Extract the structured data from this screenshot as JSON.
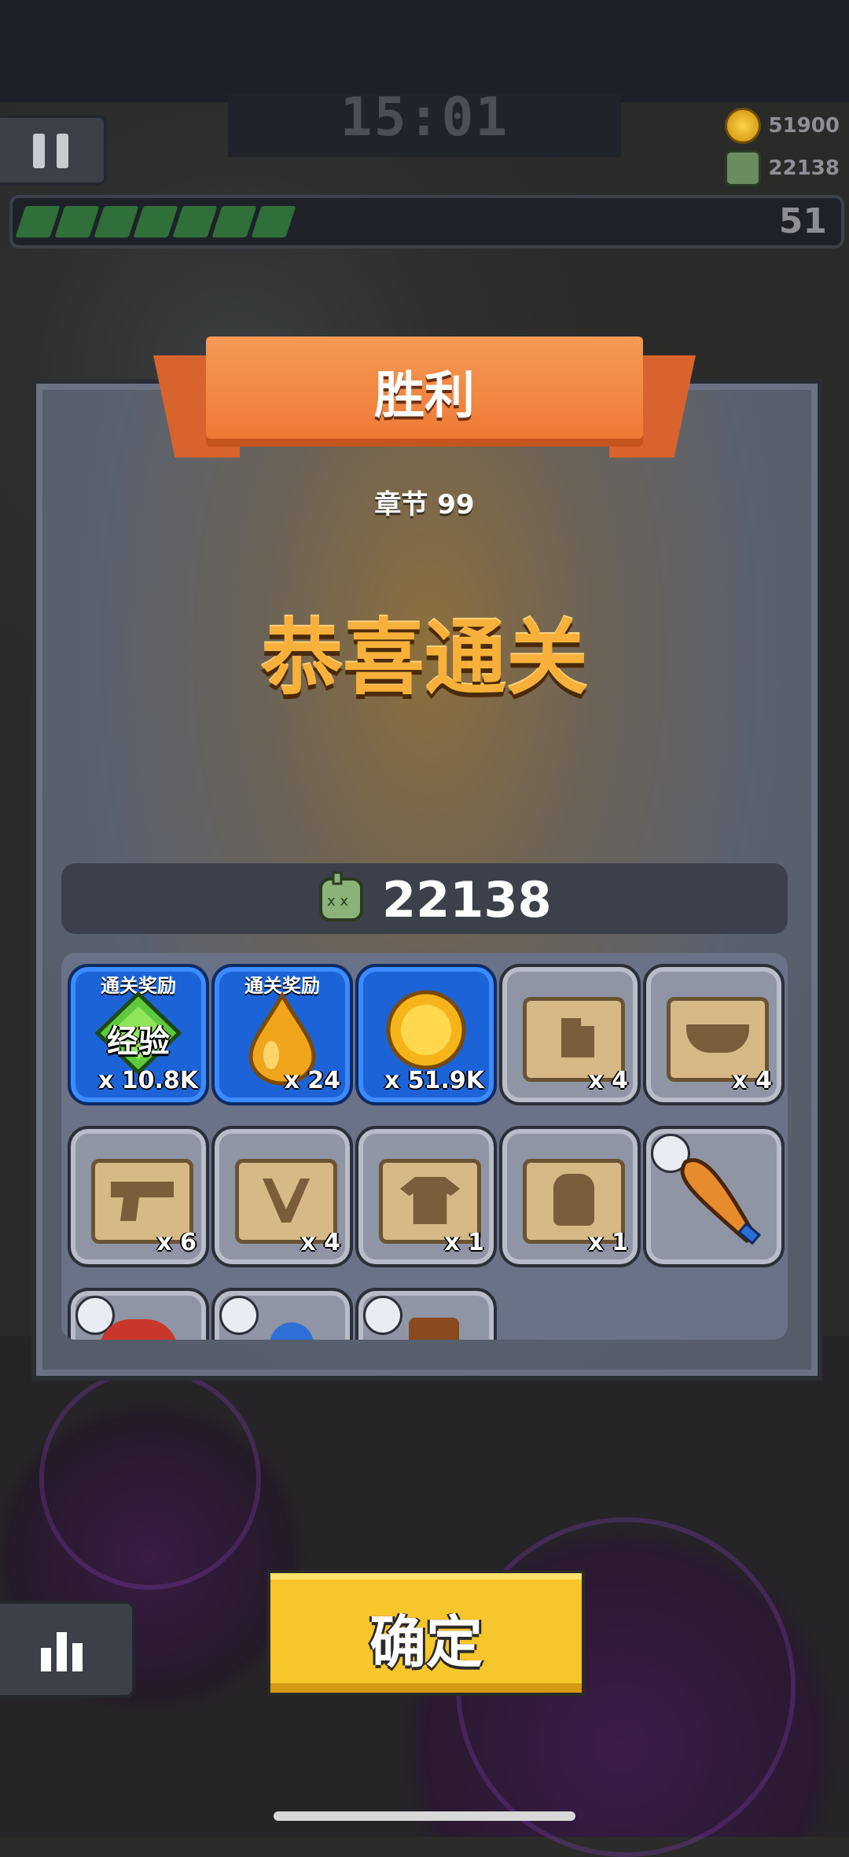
{
  "hud": {
    "timer": "15:01",
    "gold": "51900",
    "kills": "22138",
    "level": "51",
    "xp_progress": 0.31
  },
  "dialog": {
    "title": "胜利",
    "chapter": "章节 99",
    "headline": "恭喜通关",
    "kill_count": "22138"
  },
  "rewards": [
    {
      "tag": "通关奖励",
      "name": "经验",
      "count": "x 10.8K",
      "icon": "exp-gem-icon"
    },
    {
      "tag": "通关奖励",
      "count": "x 24",
      "icon": "oil-drop-icon"
    },
    {
      "count": "x 51.9K",
      "icon": "gold-coin-icon"
    },
    {
      "count": "x 4",
      "icon": "armor-scroll-icon"
    },
    {
      "count": "x 4",
      "icon": "belt-scroll-icon"
    },
    {
      "count": "x 6",
      "icon": "weapon-scroll-icon"
    },
    {
      "count": "x 4",
      "icon": "necklace-scroll-icon"
    },
    {
      "count": "x 1",
      "icon": "clothes-scroll-icon"
    },
    {
      "count": "x 1",
      "icon": "glove-scroll-icon"
    },
    {
      "icon": "baseball-bat-icon"
    },
    {
      "icon": "belt-item-icon"
    },
    {
      "icon": "glove-item-icon"
    },
    {
      "icon": "boots-item-icon"
    }
  ],
  "confirm_label": "确定",
  "colors": {
    "ribbon": "#ee7a35",
    "headline": "#f7b13b",
    "confirm": "#f7c52c",
    "blue_tile": "#1d63d8",
    "grey_tile": "#8f95a4",
    "xp_bar": "#2f6f3a"
  }
}
